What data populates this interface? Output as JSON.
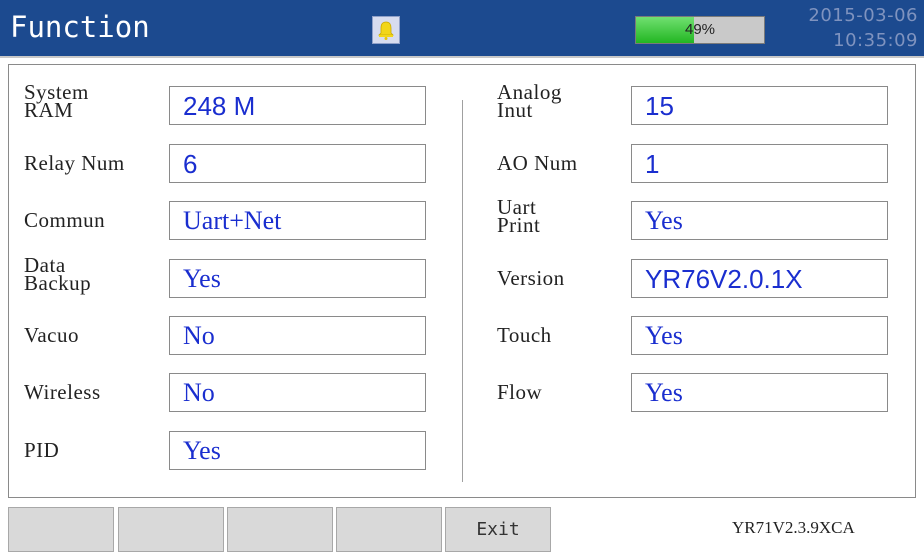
{
  "header": {
    "title": "Function",
    "battery_percent": 49,
    "battery_label": "49%",
    "date": "2015-03-06",
    "time": "10:35:09",
    "alarm_icon": "bell-icon"
  },
  "left": [
    {
      "label1": "System",
      "label2": "RAM",
      "value": "248 M",
      "font": "sans"
    },
    {
      "label1": "Relay Num",
      "label2": "",
      "value": "6",
      "font": "sans"
    },
    {
      "label1": "Commun",
      "label2": "",
      "value": "Uart+Net",
      "font": "serif"
    },
    {
      "label1": "Data",
      "label2": "Backup",
      "value": "Yes",
      "font": "serif"
    },
    {
      "label1": "Vacuo",
      "label2": "",
      "value": "No",
      "font": "serif"
    },
    {
      "label1": "Wireless",
      "label2": "",
      "value": "No",
      "font": "serif"
    },
    {
      "label1": "PID",
      "label2": "",
      "value": "Yes",
      "font": "serif"
    }
  ],
  "right": [
    {
      "label1": "Analog",
      "label2": "Inut",
      "value": "15",
      "font": "sans"
    },
    {
      "label1": "AO Num",
      "label2": "",
      "value": "1",
      "font": "sans"
    },
    {
      "label1": "Uart",
      "label2": "Print",
      "value": "Yes",
      "font": "serif"
    },
    {
      "label1": "Version",
      "label2": "",
      "value": "YR76V2.0.1X",
      "font": "sans"
    },
    {
      "label1": "Touch",
      "label2": "",
      "value": "Yes",
      "font": "serif"
    },
    {
      "label1": "Flow",
      "label2": "",
      "value": "Yes",
      "font": "serif"
    }
  ],
  "footer": {
    "buttons": [
      "",
      "",
      "",
      "",
      "Exit"
    ],
    "version": "YR71V2.3.9XCA"
  }
}
